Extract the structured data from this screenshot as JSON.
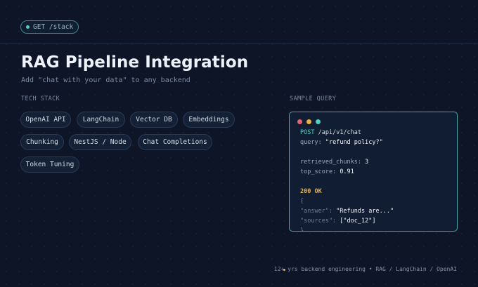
{
  "route_pill": {
    "label": "GET /stack"
  },
  "header": {
    "title": "RAG Pipeline Integration",
    "subtitle": "Add \"chat with your data\" to any backend"
  },
  "tech_stack": {
    "label": "TECH STACK",
    "chips": [
      "OpenAI API",
      "LangChain",
      "Vector DB",
      "Embeddings",
      "Chunking",
      "NestJS / Node",
      "Chat Completions",
      "Token Tuning"
    ]
  },
  "sample_query": {
    "label": "SAMPLE QUERY",
    "request_method": "POST",
    "request_path": "/api/v1/chat",
    "query_key": "query:",
    "query_value": "\"refund policy?\"",
    "retrieved_key": "retrieved_chunks:",
    "retrieved_value": "3",
    "score_key": "top_score:",
    "score_value": "0.91",
    "status": "200 OK",
    "brace_open": "{",
    "answer_key": "\"answer\":",
    "answer_value": "\"Refunds are...\"",
    "sources_key": "\"sources\":",
    "sources_value": "[\"doc_12\"]",
    "brace_close": "}"
  },
  "footer": {
    "text": "12+ yrs backend engineering • RAG / LangChain / OpenAI"
  },
  "colors": {
    "accent": "#4fd1c5",
    "status": "#e8b04a",
    "background": "#0d1526"
  }
}
